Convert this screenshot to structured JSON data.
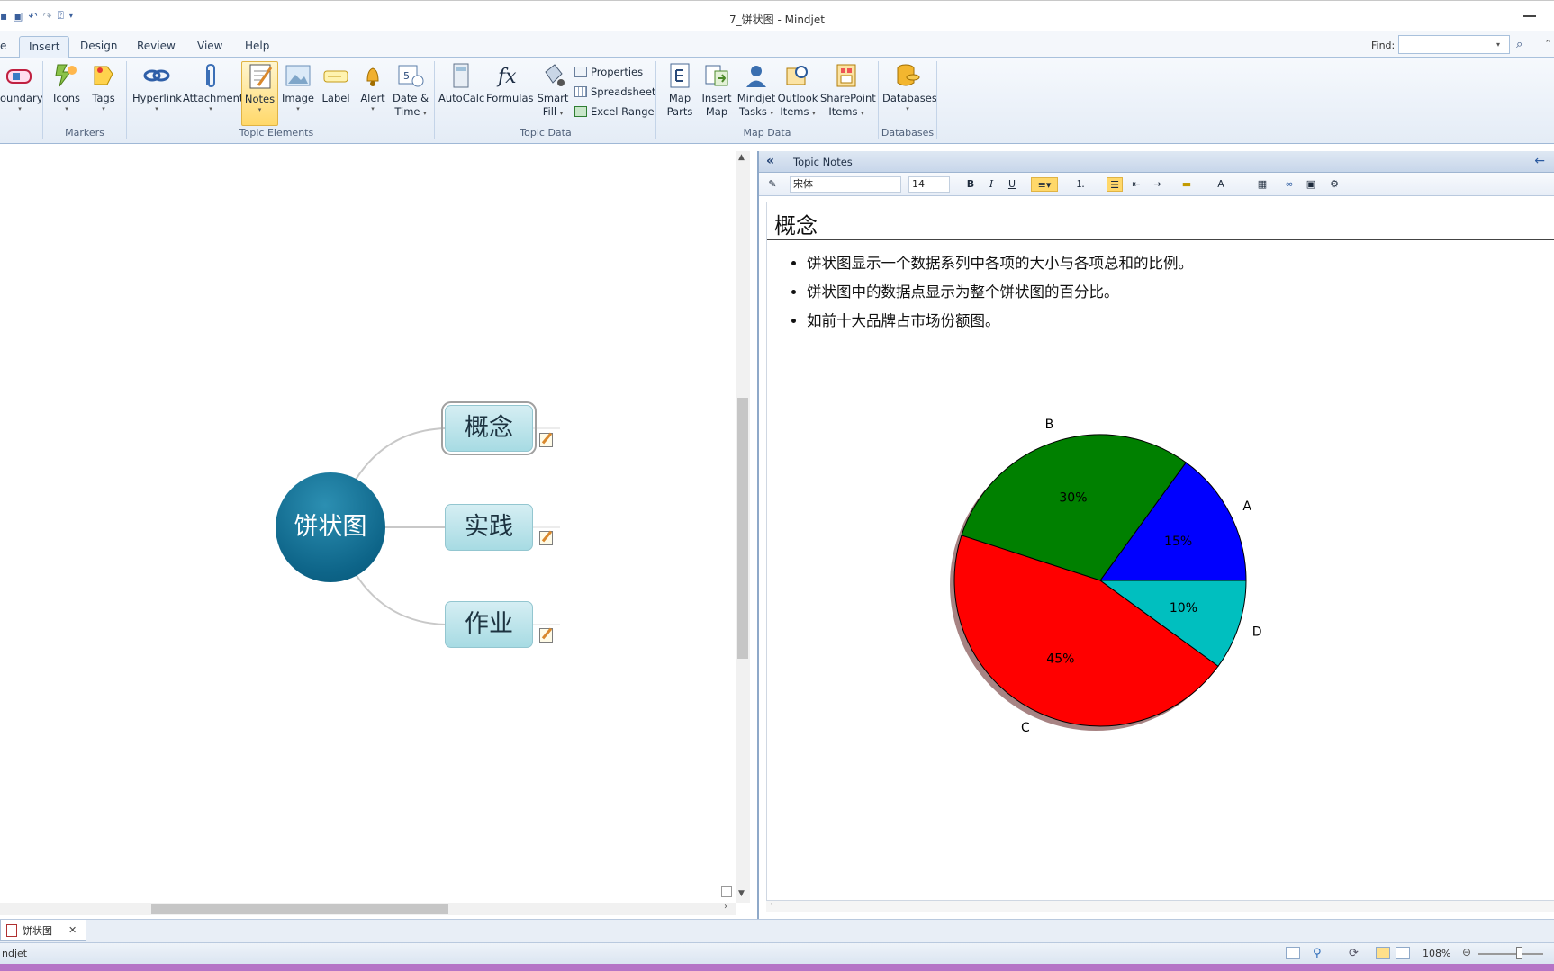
{
  "window": {
    "title": "7_饼状图 - Mindjet"
  },
  "ribbon": {
    "tabs": [
      "e",
      "Insert",
      "Design",
      "Review",
      "View",
      "Help"
    ],
    "active_tab": "Insert",
    "find_label": "Find:",
    "groups": {
      "markers": "Markers",
      "topic_elements": "Topic Elements",
      "topic_data": "Topic Data",
      "map_data": "Map Data",
      "databases": "Databases"
    },
    "buttons": {
      "boundary": "oundary",
      "icons": "Icons",
      "tags": "Tags",
      "hyperlink": "Hyperlink",
      "attachment": "Attachment",
      "notes": "Notes",
      "image": "Image",
      "label": "Label",
      "alert": "Alert",
      "date_time_1": "Date &",
      "date_time_2": "Time",
      "autocalc": "AutoCalc",
      "formulas": "Formulas",
      "smart_fill_1": "Smart",
      "smart_fill_2": "Fill",
      "properties": "Properties",
      "spreadsheet": "Spreadsheet",
      "excel_range": "Excel Range",
      "map_parts_1": "Map",
      "map_parts_2": "Parts",
      "insert_map_1": "Insert",
      "insert_map_2": "Map",
      "mindjet_tasks_1": "Mindjet",
      "mindjet_tasks_2": "Tasks",
      "outlook_items_1": "Outlook",
      "outlook_items_2": "Items",
      "sharepoint_items_1": "SharePoint",
      "sharepoint_items_2": "Items",
      "databases": "Databases"
    }
  },
  "map": {
    "central_topic": "饼状图",
    "subtopics": [
      "概念",
      "实践",
      "作业"
    ],
    "selected_subtopic": "概念"
  },
  "notes_panel": {
    "header": "Topic Notes",
    "font_name": "宋体",
    "font_size": "14",
    "heading": "概念",
    "bullets": [
      "饼状图显示一个数据系列中各项的大小与各项总和的比例。",
      "饼状图中的数据点显示为整个饼状图的百分比。",
      "如前十大品牌占市场份额图。"
    ]
  },
  "chart_data": {
    "type": "pie",
    "title": "",
    "start_angle_deg": 0,
    "direction": "counterclockwise",
    "shadow": true,
    "categories": [
      "A",
      "B",
      "C",
      "D"
    ],
    "values": [
      15,
      30,
      45,
      10
    ],
    "labels": [
      "15%",
      "30%",
      "45%",
      "10%"
    ],
    "colors": [
      "#0000ff",
      "#008000",
      "#ff0000",
      "#00bfbf"
    ]
  },
  "bottom": {
    "doc_tab": "饼状图",
    "status_app": "ndjet",
    "zoom": "108%"
  }
}
